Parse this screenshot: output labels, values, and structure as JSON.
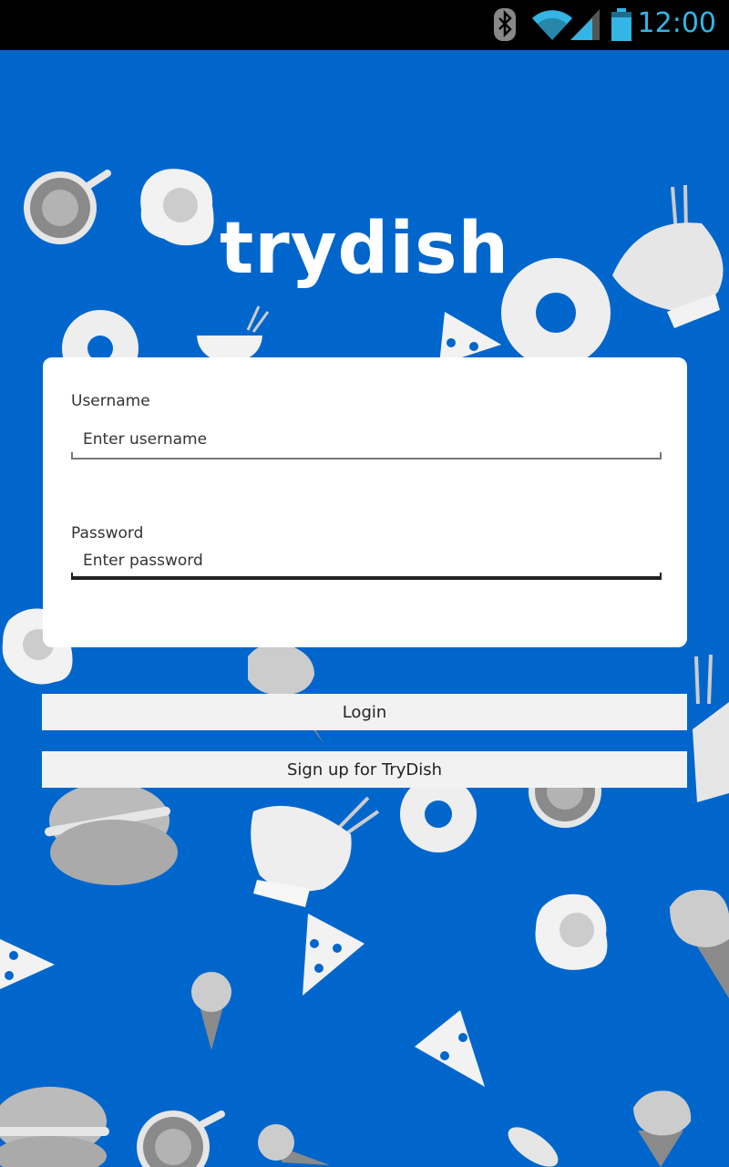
{
  "status_bar": {
    "time": "12:00",
    "icons": [
      "bluetooth-icon",
      "wifi-icon",
      "signal-icon",
      "battery-icon"
    ],
    "accent_color": "#33b5e5"
  },
  "app": {
    "logo_text": "trydish",
    "background_color": "#0066cc"
  },
  "login_form": {
    "username_label": "Username",
    "username_placeholder": "Enter username",
    "username_value": "",
    "password_label": "Password",
    "password_placeholder": "Enter password",
    "password_value": ""
  },
  "actions": {
    "login_label": "Login",
    "signup_label": "Sign up for TryDish"
  }
}
